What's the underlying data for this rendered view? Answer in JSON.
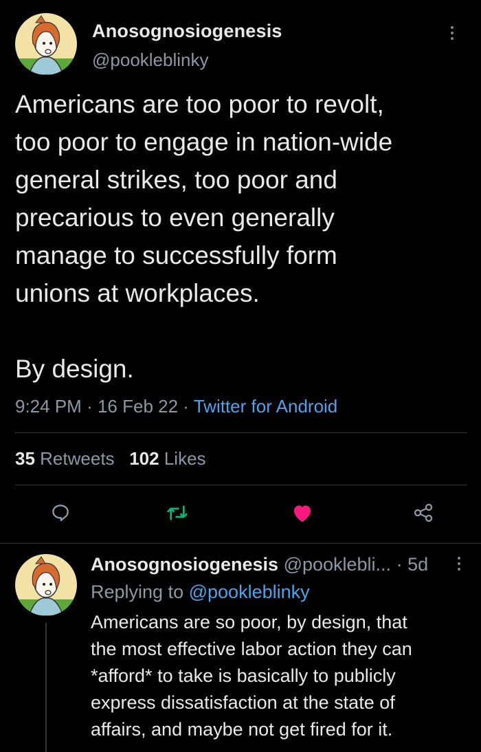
{
  "main_tweet": {
    "author_name": "Anosognosiogenesis",
    "author_handle": "@pookleblinky",
    "text": "Americans are too poor to revolt,\ntoo poor to engage in nation-wide\ngeneral strikes, too poor and\nprecarious to even generally\nmanage to successfully form\nunions at workplaces.\n\nBy design.",
    "time": "9:24 PM",
    "date": "16 Feb 22",
    "separator": "·",
    "source": "Twitter for Android",
    "retweets_count": "35",
    "retweets_label": "Retweets",
    "likes_count": "102",
    "likes_label": "Likes",
    "liked": true
  },
  "actions": [
    {
      "icon": "reply-icon",
      "color": "#8b98a5"
    },
    {
      "icon": "retweet-icon",
      "color": "#00ba7c"
    },
    {
      "icon": "heart-icon",
      "color": "#f91880"
    },
    {
      "icon": "share-icon",
      "color": "#8b98a5"
    }
  ],
  "reply_tweet": {
    "author_name": "Anosognosiogenesis",
    "author_handle": "@pooklebli...",
    "age": "· 5d",
    "replying_prefix": "Replying to",
    "replying_to": "@pookleblinky",
    "text": "Americans are so poor, by design, that\nthe most effective labor action they can\n*afford* to take is basically to publicly\nexpress dissatisfaction at the state of\naffairs, and maybe not get fired for it."
  },
  "colors": {
    "background": "#000000",
    "text": "#e7e9ea",
    "secondary": "#8b98a5",
    "link": "#4aa5ee",
    "retweet": "#00ba7c",
    "like": "#f91880"
  }
}
